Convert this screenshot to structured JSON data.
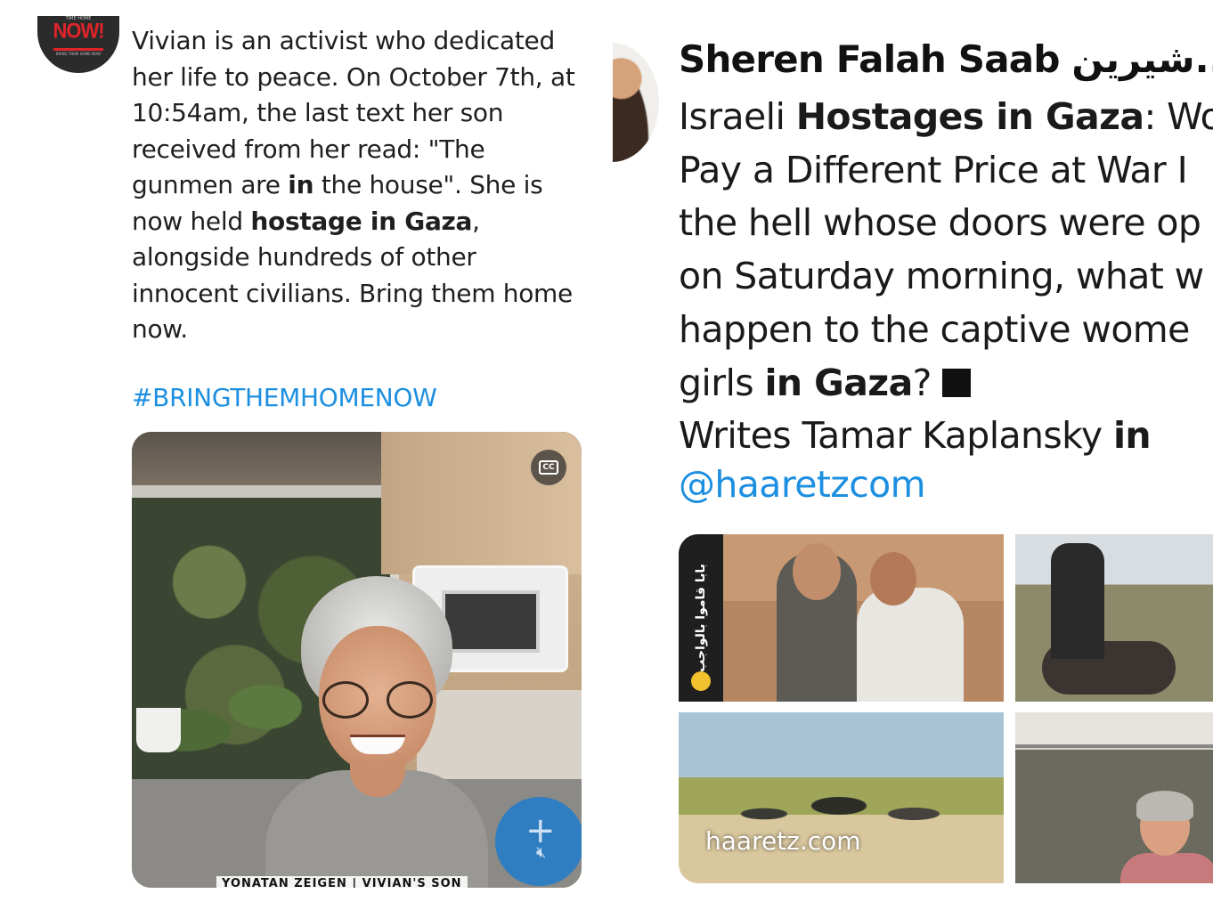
{
  "left_tweet": {
    "avatar": {
      "top_text": "TIME HOME",
      "brand": "NOW!",
      "sub_text": "BRING THEM HOME NOW"
    },
    "body_lines": [
      {
        "parts": [
          {
            "t": "Vivian is an activist who dedicated",
            "b": false
          }
        ]
      },
      {
        "parts": [
          {
            "t": "her life to peace. On October 7th, at",
            "b": false
          }
        ]
      },
      {
        "parts": [
          {
            "t": "10:54am, the last text her son",
            "b": false
          }
        ]
      },
      {
        "parts": [
          {
            "t": "received from her read: \"The",
            "b": false
          }
        ]
      },
      {
        "parts": [
          {
            "t": "gunmen are ",
            "b": false
          },
          {
            "t": "in",
            "b": true
          },
          {
            "t": " the house\". She is",
            "b": false
          }
        ]
      },
      {
        "parts": [
          {
            "t": "now held ",
            "b": false
          },
          {
            "t": "hostage in Gaza",
            "b": true
          },
          {
            "t": ",",
            "b": false
          }
        ]
      },
      {
        "parts": [
          {
            "t": "alongside hundreds of other",
            "b": false
          }
        ]
      },
      {
        "parts": [
          {
            "t": "innocent civilians. Bring them home",
            "b": false
          }
        ]
      },
      {
        "parts": [
          {
            "t": "now.",
            "b": false
          }
        ]
      }
    ],
    "hashtag": "#BRINGTHEMHOMENOW",
    "video": {
      "cc_label": "CC",
      "add_icon": "plus-icon",
      "mute_icon": "speaker-muted-icon",
      "caption": "YONATAN ZEIGEN | VIVIAN'S SON"
    }
  },
  "right_tweet": {
    "author_name": "Sheren Falah Saab شيرين...",
    "body_lines": [
      {
        "parts": [
          {
            "t": "Israeli ",
            "b": false
          },
          {
            "t": "Hostages in Gaza",
            "b": true
          },
          {
            "t": ": Wo",
            "b": false
          }
        ]
      },
      {
        "parts": [
          {
            "t": "Pay a Different Price at War I",
            "b": false
          }
        ]
      },
      {
        "parts": [
          {
            "t": "the hell whose doors were op",
            "b": false
          }
        ]
      },
      {
        "parts": [
          {
            "t": "on Saturday morning, what w",
            "b": false
          }
        ]
      },
      {
        "parts": [
          {
            "t": "happen to the captive wome",
            "b": false
          }
        ]
      },
      {
        "parts": [
          {
            "t": "girls ",
            "b": false
          },
          {
            "t": "in Gaza",
            "b": true
          },
          {
            "t": "?",
            "b": false
          }
        ]
      },
      {
        "parts": [
          {
            "t": "Writes Tamar Kaplansky ",
            "b": false
          },
          {
            "t": "in",
            "b": true
          }
        ]
      }
    ],
    "mention": "@haaretzcom",
    "card": {
      "arabic_strip": "بابا قاموا بالواجب",
      "domain": "haaretz.com"
    }
  },
  "colors": {
    "link": "#1d8fe0",
    "brand_red": "#e0242a",
    "mute_button": "#2f7ec2"
  }
}
